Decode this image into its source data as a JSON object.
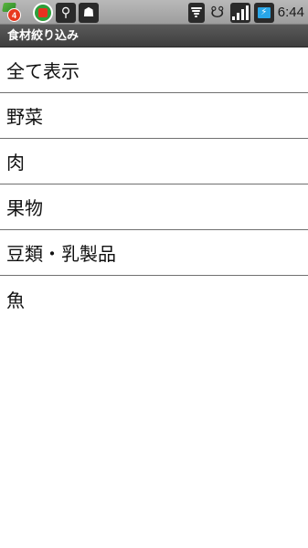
{
  "status_bar": {
    "notification_count": "4",
    "time": "6:44",
    "icons": [
      "notification-icon",
      "app-icon",
      "usb-icon",
      "android-debug-icon",
      "wifi-icon",
      "sync-icon",
      "signal-icon",
      "battery-icon"
    ]
  },
  "title_bar": {
    "title": "食材絞り込み"
  },
  "list": {
    "items": [
      {
        "label": "全て表示"
      },
      {
        "label": "野菜"
      },
      {
        "label": "肉"
      },
      {
        "label": "果物"
      },
      {
        "label": "豆類・乳製品"
      },
      {
        "label": "魚"
      }
    ]
  }
}
